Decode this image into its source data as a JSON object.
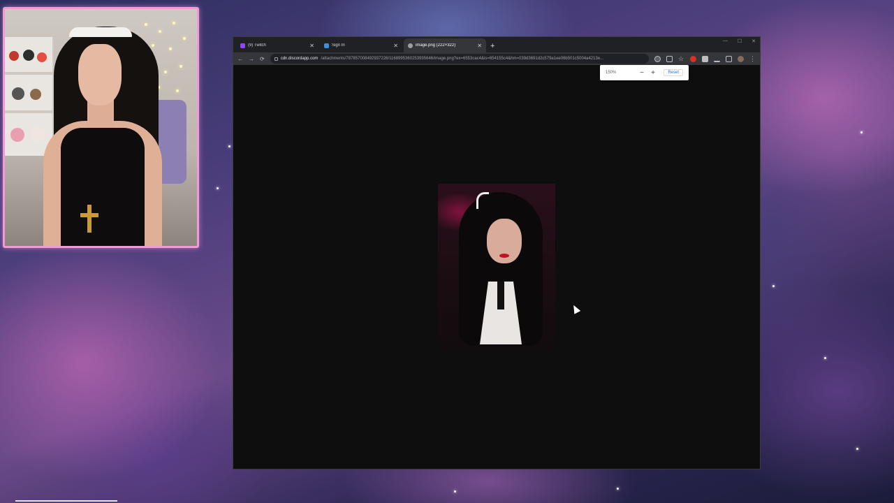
{
  "browser": {
    "tabs": [
      {
        "title": "(9) Twitch",
        "favicon_color": "#9146ff",
        "active": false
      },
      {
        "title": "Sign In",
        "favicon_color": "#3c8fd8",
        "active": false
      },
      {
        "title": "image.png (222×322)",
        "favicon_color": "#9aa0a6",
        "active": true
      }
    ],
    "new_tab_label": "+",
    "window_controls": {
      "minimize": "—",
      "maximize": "☐",
      "close": "✕"
    },
    "nav": {
      "back": "←",
      "forward": "→",
      "reload": "⟳"
    },
    "address": {
      "host": "cdn.discordapp.com",
      "path": "/attachments/787857008492937226/1168995360253935646/image.png?ex=6553cac4&is=654155c4&hm=039d3691d2c579a1ee06b501c5004a4213e..."
    },
    "toolbar_icons": [
      "zoom-icon",
      "share-icon",
      "bookmark-star-icon",
      "adblock-icon",
      "extensions-icon",
      "download-icon",
      "sidebar-icon",
      "profile-avatar",
      "menu-icon"
    ],
    "zoom_popup": {
      "value": "150%",
      "minus": "−",
      "plus": "+",
      "reset": "Reset"
    }
  },
  "colors": {
    "webcam_border": "#f29ad8",
    "browser_bg": "#0e0e0e",
    "chrome_tabbar": "#202124",
    "chrome_toolbar": "#35363a"
  }
}
